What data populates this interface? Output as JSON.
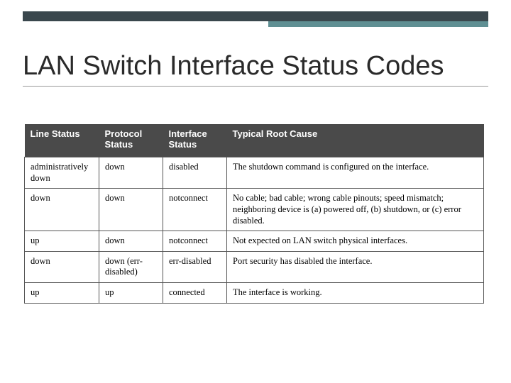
{
  "title": "LAN Switch Interface Status Codes",
  "table": {
    "headers": {
      "line_status": "Line Status",
      "protocol_status": "Protocol Status",
      "interface_status": "Interface Status",
      "root_cause": "Typical Root Cause"
    },
    "rows": [
      {
        "line_status": "administratively down",
        "protocol_status": "down",
        "interface_status": "disabled",
        "root_cause": "The shutdown command is configured on the interface."
      },
      {
        "line_status": "down",
        "protocol_status": "down",
        "interface_status": "notconnect",
        "root_cause": "No cable; bad cable; wrong cable pinouts; speed mismatch; neighboring device is (a) powered off, (b) shutdown, or (c) error disabled."
      },
      {
        "line_status": "up",
        "protocol_status": "down",
        "interface_status": "notconnect",
        "root_cause": "Not expected on LAN switch physical interfaces."
      },
      {
        "line_status": "down",
        "protocol_status": "down (err-disabled)",
        "interface_status": "err-disabled",
        "root_cause": "Port security has disabled the interface."
      },
      {
        "line_status": "up",
        "protocol_status": "up",
        "interface_status": "connected",
        "root_cause": "The interface is working."
      }
    ]
  }
}
